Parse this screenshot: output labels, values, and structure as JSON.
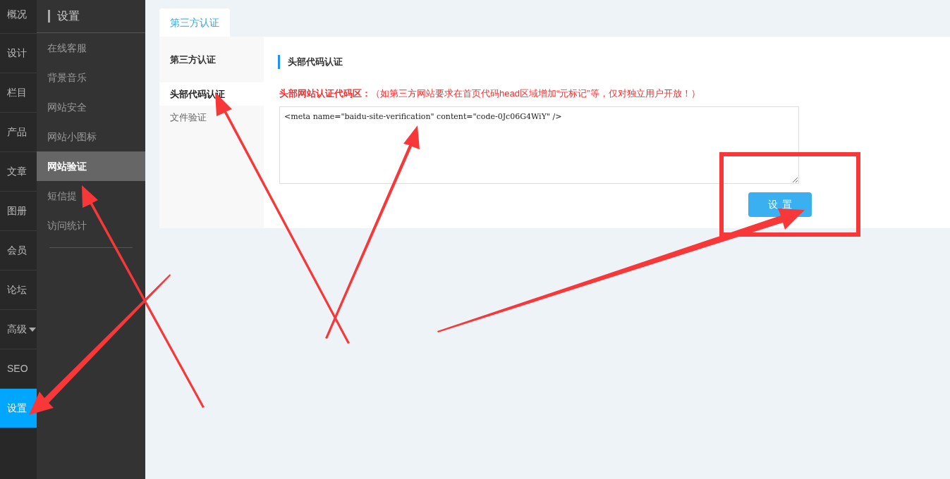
{
  "rail": {
    "items": [
      {
        "label": "概况",
        "selected": false,
        "dropdown": false
      },
      {
        "label": "设计",
        "selected": false,
        "dropdown": false
      },
      {
        "label": "栏目",
        "selected": false,
        "dropdown": false
      },
      {
        "label": "产品",
        "selected": false,
        "dropdown": false
      },
      {
        "label": "文章",
        "selected": false,
        "dropdown": false
      },
      {
        "label": "图册",
        "selected": false,
        "dropdown": false
      },
      {
        "label": "会员",
        "selected": false,
        "dropdown": false
      },
      {
        "label": "论坛",
        "selected": false,
        "dropdown": false
      },
      {
        "label": "高级",
        "selected": false,
        "dropdown": true
      },
      {
        "label": "SEO",
        "selected": false,
        "dropdown": false
      },
      {
        "label": "设置",
        "selected": true,
        "dropdown": false
      }
    ]
  },
  "submenu": {
    "title": "设置",
    "items": [
      {
        "label": "在线客服",
        "selected": false
      },
      {
        "label": "背景音乐",
        "selected": false
      },
      {
        "label": "网站安全",
        "selected": false
      },
      {
        "label": "网站小图标",
        "selected": false
      },
      {
        "label": "网站验证",
        "selected": true
      },
      {
        "label": "短信提",
        "selected": false
      },
      {
        "label": "访问统计",
        "selected": false
      }
    ]
  },
  "tabs": [
    {
      "label": "第三方认证",
      "selected": true
    }
  ],
  "side_nav": {
    "title": "第三方认证",
    "items": [
      {
        "label": "头部代码认证",
        "selected": true
      },
      {
        "label": "文件验证",
        "selected": false
      }
    ]
  },
  "section": {
    "title": "头部代码认证",
    "field_label": "头部网站认证代码区：",
    "hint": "（如第三方网站要求在首页代码head区域增加“元标记”等，仅对独立用户开放！）",
    "code": "<meta name=\"baidu-site-verification\" content=\"code-0Jc06G4WiY\" />",
    "button": "设置"
  }
}
